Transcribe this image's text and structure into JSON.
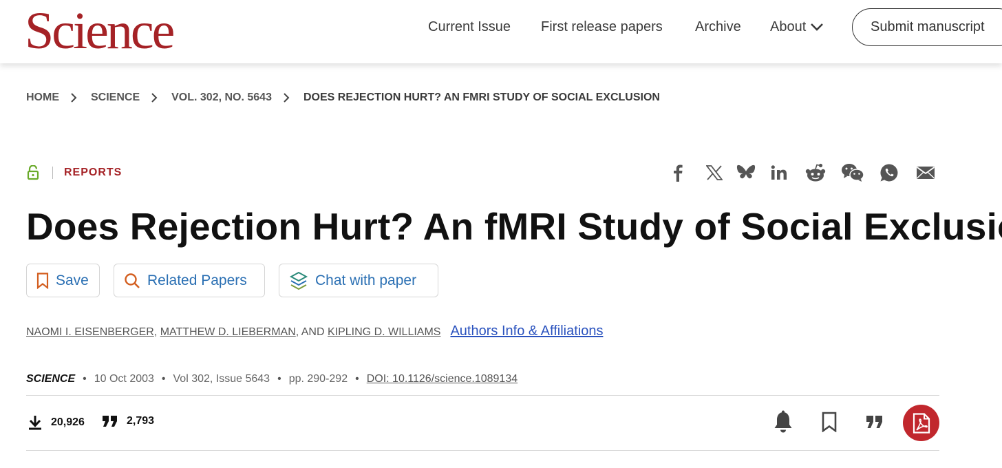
{
  "header": {
    "logo_text": "Science",
    "nav": [
      "Current Issue",
      "First release papers",
      "Archive"
    ],
    "about_label": "About",
    "submit_label": "Submit manuscript"
  },
  "breadcrumb": [
    "HOME",
    "SCIENCE",
    "VOL. 302, NO. 5643",
    "DOES REJECTION HURT? AN FMRI STUDY OF SOCIAL EXCLUSION"
  ],
  "category": "REPORTS",
  "share_icons": [
    "facebook-icon",
    "x-icon",
    "bluesky-icon",
    "linkedin-icon",
    "reddit-icon",
    "wechat-icon",
    "whatsapp-icon",
    "email-icon"
  ],
  "title": "Does Rejection Hurt? An fMRI Study of Social Exclusion",
  "actions": {
    "save": "Save",
    "related": "Related Papers",
    "chat": "Chat with paper"
  },
  "authors": {
    "names": [
      "NAOMI I. EISENBERGER",
      "MATTHEW D. LIEBERMAN",
      "KIPLING D. WILLIAMS"
    ],
    "separator_1": ", ",
    "separator_2": ", AND ",
    "affiliations_label": "Authors Info & Affiliations"
  },
  "meta": {
    "journal": "SCIENCE",
    "date": "10 Oct 2003",
    "volume": "Vol 302, Issue 5643",
    "pages": "pp. 290-292",
    "doi": "DOI: 10.1126/science.1089134"
  },
  "metrics": {
    "downloads": "20,926",
    "citations": "2,793"
  },
  "colors": {
    "brand": "#a52226",
    "link": "#2a6fb3",
    "lock": "#6aaa2a",
    "pdf": "#c1272d"
  }
}
